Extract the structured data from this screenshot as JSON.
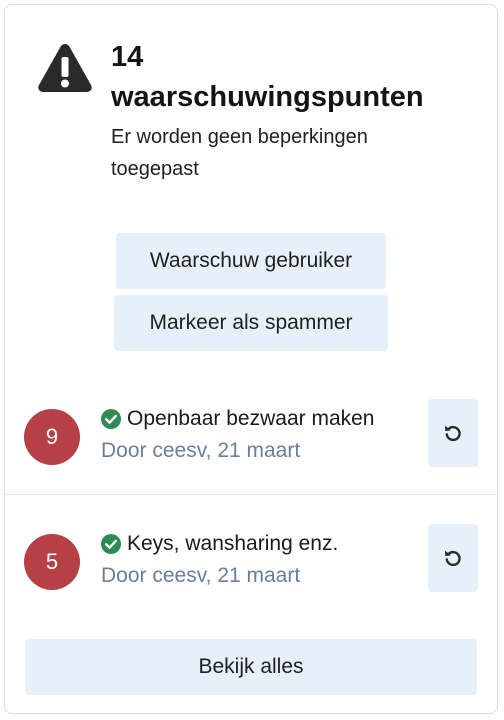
{
  "header": {
    "icon": "warning-triangle-icon",
    "points_count": "14",
    "points_label": "waarschuwingspunten",
    "subtitle": "Er worden geen beperkingen toegepast"
  },
  "actions": {
    "warn_user": "Waarschuw gebruiker",
    "mark_spammer": "Markeer als spammer"
  },
  "warnings": [
    {
      "points": "9",
      "title": "Openbaar bezwaar maken",
      "meta": "Door ceesv, 21 maart",
      "status_icon": "check-circle-icon",
      "action_icon": "undo-icon"
    },
    {
      "points": "5",
      "title": "Keys, wansharing enz.",
      "meta": "Door ceesv, 21 maart",
      "status_icon": "check-circle-icon",
      "action_icon": "undo-icon"
    }
  ],
  "footer": {
    "view_all": "Bekijk alles"
  },
  "colors": {
    "badge": "#b64046",
    "button_bg": "#e6f0f9",
    "check": "#2e8b57",
    "meta_text": "#6b7f96"
  }
}
